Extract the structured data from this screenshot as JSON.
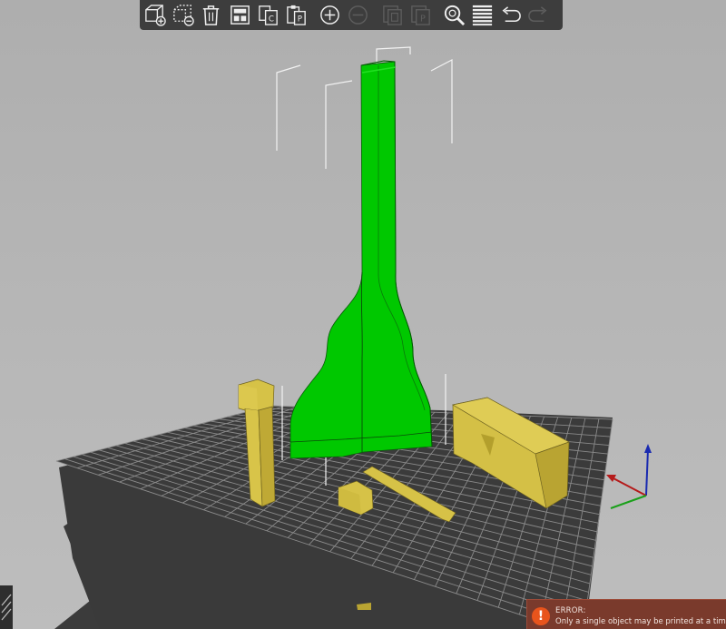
{
  "toolbar": {
    "items": [
      {
        "name": "add-icon",
        "label": "Add"
      },
      {
        "name": "delete-icon",
        "label": "Delete"
      },
      {
        "name": "delete-all-icon",
        "label": "Delete all"
      },
      {
        "name": "arrange-icon",
        "label": "Arrange"
      },
      {
        "name": "copy-icon",
        "label": "Copy"
      },
      {
        "name": "paste-icon",
        "label": "Paste"
      },
      {
        "name": "add-instance-icon",
        "label": "Add instance"
      },
      {
        "name": "remove-instance-icon",
        "label": "Remove instance",
        "disabled": true
      },
      {
        "name": "split-objects-icon",
        "label": "Split to objects",
        "disabled": true
      },
      {
        "name": "split-parts-icon",
        "label": "Split to parts",
        "disabled": true
      },
      {
        "name": "search-icon",
        "label": "Search"
      },
      {
        "name": "layers-icon",
        "label": "Layers editing"
      },
      {
        "name": "undo-icon",
        "label": "Undo"
      },
      {
        "name": "redo-icon",
        "label": "Redo",
        "disabled": true
      }
    ]
  },
  "colors": {
    "background": "#b4b4b4",
    "toolbar": "#3d3d3d",
    "selected_object": "#00cc00",
    "other_objects": "#d4c24a",
    "bed": "#3c3c3c",
    "grid": "#8c8c8c",
    "error_bg": "#7a3a2c",
    "error_icon": "#e8541c"
  },
  "notification": {
    "title": "ERROR:",
    "message": "Only a single object may be printed at a time in S...",
    "icon": "!"
  }
}
